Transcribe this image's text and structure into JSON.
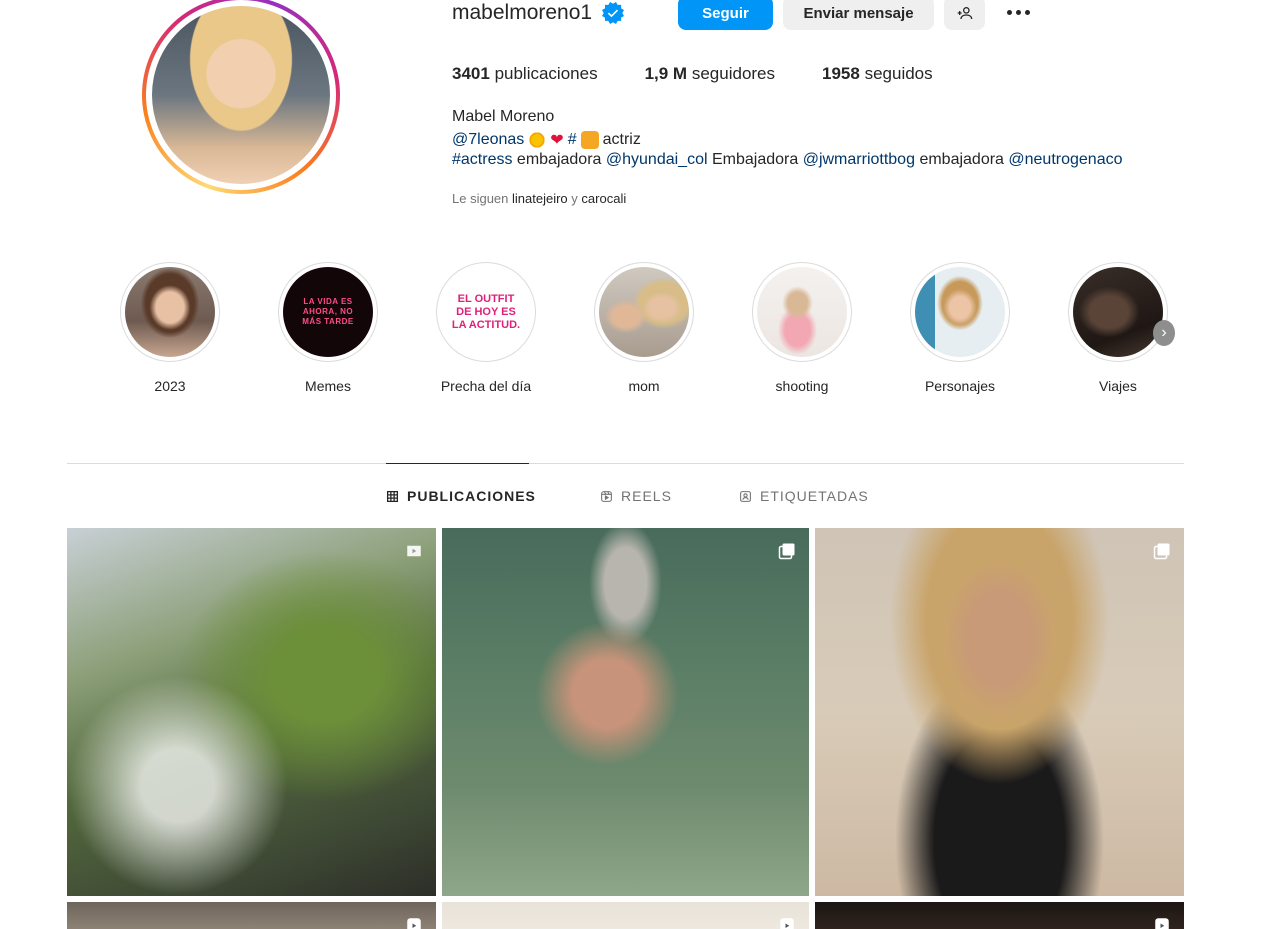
{
  "profile": {
    "username": "mabelmoreno1",
    "follow_label": "Seguir",
    "message_label": "Enviar mensaje",
    "stats": {
      "posts_count": "3401",
      "posts_label": "publicaciones",
      "followers_count": "1,9 M",
      "followers_label": "seguidores",
      "following_count": "1958",
      "following_label": "seguidos"
    },
    "full_name": "Mabel Moreno",
    "bio_line1_mention": "@7leonas",
    "bio_line1_hashtag": "#",
    "bio_line1_text": "actriz",
    "bio_line2": {
      "tag1": "#actress",
      "text1": "embajadora",
      "tag2": "@hyundai_col",
      "text2": "Embajadora",
      "tag3": "@jwmarriottbog",
      "text3": "embajadora",
      "tag4": "@neutrogenaco"
    },
    "followed_by_prefix": "Le siguen",
    "followed_by_user1": "linatejeiro",
    "followed_by_and": "y",
    "followed_by_user2": "carocali"
  },
  "highlights": [
    {
      "label": "2023"
    },
    {
      "label": "Memes",
      "cover_text": "LA VIDA ES AHORA, NO MÁS TARDE"
    },
    {
      "label": "Precha del día",
      "cover_text": "EL OUTFIT DE HOY ES LA ACTITUD."
    },
    {
      "label": "mom"
    },
    {
      "label": "shooting"
    },
    {
      "label": "Personajes"
    },
    {
      "label": "Viajes"
    }
  ],
  "tabs": [
    {
      "label": "PUBLICACIONES",
      "icon": "grid-icon",
      "active": true
    },
    {
      "label": "REELS",
      "icon": "reels-icon",
      "active": false
    },
    {
      "label": "ETIQUETADAS",
      "icon": "tagged-icon",
      "active": false
    }
  ],
  "posts": [
    {
      "type": "reel-icon"
    },
    {
      "type": "carousel-icon"
    },
    {
      "type": "carousel-icon"
    },
    {
      "type": "reel-icon"
    },
    {
      "type": "reel-icon"
    },
    {
      "type": "reel-icon"
    }
  ],
  "colors": {
    "accent": "#0095f6",
    "link": "#00376b",
    "secondary_button": "#efefef",
    "muted_text": "#737373"
  }
}
